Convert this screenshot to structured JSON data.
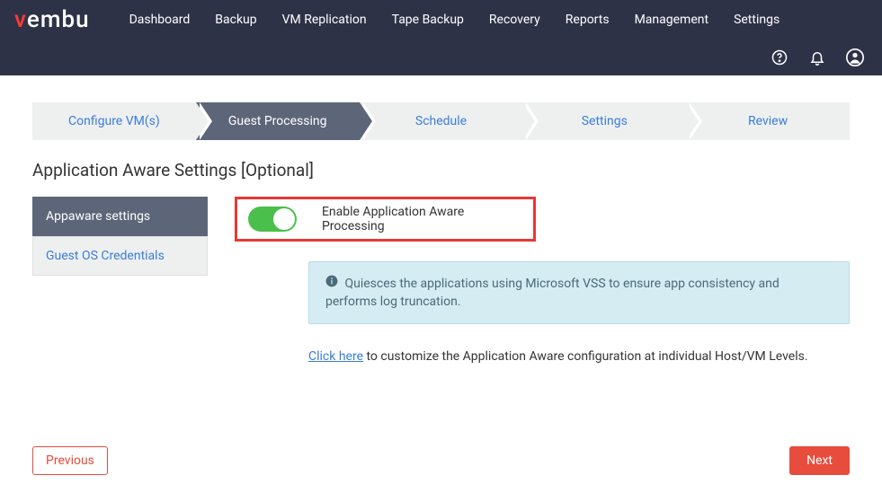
{
  "logo": {
    "first": "v",
    "rest": "embu"
  },
  "nav": {
    "items": [
      "Dashboard",
      "Backup",
      "VM Replication",
      "Tape Backup",
      "Recovery",
      "Reports",
      "Management",
      "Settings"
    ]
  },
  "wizard": {
    "steps": [
      "Configure VM(s)",
      "Guest Processing",
      "Schedule",
      "Settings",
      "Review"
    ],
    "activeIndex": 1
  },
  "page": {
    "title": "Application Aware Settings [Optional]"
  },
  "sideTabs": {
    "items": [
      "Appaware settings",
      "Guest OS Credentials"
    ],
    "activeIndex": 0
  },
  "toggle": {
    "label": "Enable Application Aware Processing",
    "on": true
  },
  "infoBox": {
    "text": "Quiesces the applications using Microsoft VSS to ensure app consistency and performs log truncation."
  },
  "desc": {
    "link": "Click here",
    "text": " to customize the Application Aware configuration at individual Host/VM Levels."
  },
  "footer": {
    "prev": "Previous",
    "next": "Next"
  }
}
